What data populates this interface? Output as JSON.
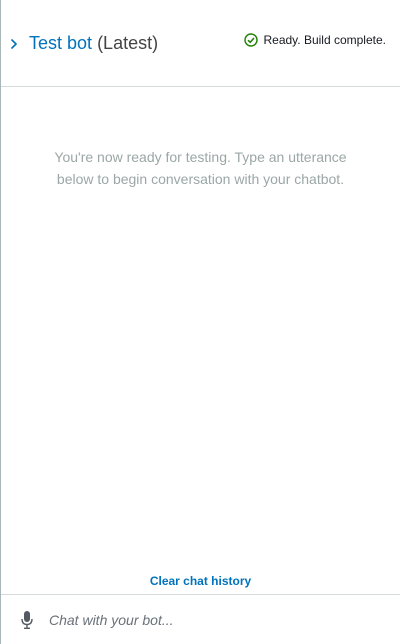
{
  "header": {
    "bot_name": "Test bot",
    "version": "(Latest)",
    "status_text": "Ready. Build complete.",
    "collapse_icon": "chevron-right-icon",
    "status_icon": "check-circle-icon"
  },
  "body": {
    "empty_line1": "You're now ready for testing. Type an utterance",
    "empty_line2": "below to begin conversation with your chatbot."
  },
  "footer": {
    "clear_label": "Clear chat history",
    "input_placeholder": "Chat with your bot...",
    "mic_icon": "microphone-icon"
  },
  "colors": {
    "link": "#0073bb",
    "success": "#1d8102",
    "muted_text": "#9ba7a6"
  }
}
